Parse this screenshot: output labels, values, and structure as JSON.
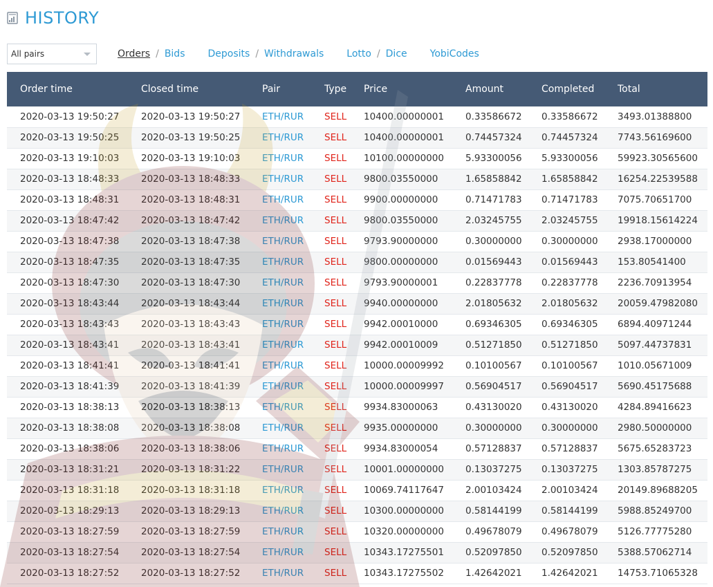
{
  "header": {
    "title": "HISTORY",
    "icon": "history-book-icon"
  },
  "filter": {
    "selected": "All pairs"
  },
  "nav": {
    "groups": [
      [
        {
          "label": "Orders",
          "active": true
        },
        {
          "label": "Bids",
          "active": false
        }
      ],
      [
        {
          "label": "Deposits",
          "active": false
        },
        {
          "label": "Withdrawals",
          "active": false
        }
      ],
      [
        {
          "label": "Lotto",
          "active": false
        },
        {
          "label": "Dice",
          "active": false
        }
      ],
      [
        {
          "label": "YobiCodes",
          "active": false
        }
      ]
    ],
    "separator": "/"
  },
  "table": {
    "columns": [
      "Order time",
      "Closed time",
      "Pair",
      "Type",
      "Price",
      "Amount",
      "Completed",
      "Total"
    ],
    "rows": [
      [
        "2020-03-13 19:50:27",
        "2020-03-13 19:50:27",
        "ETH/RUR",
        "SELL",
        "10400.00000001",
        "0.33586672",
        "0.33586672",
        "3493.01388800"
      ],
      [
        "2020-03-13 19:50:25",
        "2020-03-13 19:50:25",
        "ETH/RUR",
        "SELL",
        "10400.00000001",
        "0.74457324",
        "0.74457324",
        "7743.56169600"
      ],
      [
        "2020-03-13 19:10:03",
        "2020-03-13 19:10:03",
        "ETH/RUR",
        "SELL",
        "10100.00000000",
        "5.93300056",
        "5.93300056",
        "59923.30565600"
      ],
      [
        "2020-03-13 18:48:33",
        "2020-03-13 18:48:33",
        "ETH/RUR",
        "SELL",
        "9800.03550000",
        "1.65858842",
        "1.65858842",
        "16254.22539588"
      ],
      [
        "2020-03-13 18:48:31",
        "2020-03-13 18:48:31",
        "ETH/RUR",
        "SELL",
        "9900.00000000",
        "0.71471783",
        "0.71471783",
        "7075.70651700"
      ],
      [
        "2020-03-13 18:47:42",
        "2020-03-13 18:47:42",
        "ETH/RUR",
        "SELL",
        "9800.03550000",
        "2.03245755",
        "2.03245755",
        "19918.15614224"
      ],
      [
        "2020-03-13 18:47:38",
        "2020-03-13 18:47:38",
        "ETH/RUR",
        "SELL",
        "9793.90000000",
        "0.30000000",
        "0.30000000",
        "2938.17000000"
      ],
      [
        "2020-03-13 18:47:35",
        "2020-03-13 18:47:35",
        "ETH/RUR",
        "SELL",
        "9800.00000000",
        "0.01569443",
        "0.01569443",
        "153.80541400"
      ],
      [
        "2020-03-13 18:47:30",
        "2020-03-13 18:47:30",
        "ETH/RUR",
        "SELL",
        "9793.90000001",
        "0.22837778",
        "0.22837778",
        "2236.70913954"
      ],
      [
        "2020-03-13 18:43:44",
        "2020-03-13 18:43:44",
        "ETH/RUR",
        "SELL",
        "9940.00000000",
        "2.01805632",
        "2.01805632",
        "20059.47982080"
      ],
      [
        "2020-03-13 18:43:43",
        "2020-03-13 18:43:43",
        "ETH/RUR",
        "SELL",
        "9942.00010000",
        "0.69346305",
        "0.69346305",
        "6894.40971244"
      ],
      [
        "2020-03-13 18:43:41",
        "2020-03-13 18:43:41",
        "ETH/RUR",
        "SELL",
        "9942.00010009",
        "0.51271850",
        "0.51271850",
        "5097.44737831"
      ],
      [
        "2020-03-13 18:41:41",
        "2020-03-13 18:41:41",
        "ETH/RUR",
        "SELL",
        "10000.00009992",
        "0.10100567",
        "0.10100567",
        "1010.05671009"
      ],
      [
        "2020-03-13 18:41:39",
        "2020-03-13 18:41:39",
        "ETH/RUR",
        "SELL",
        "10000.00009997",
        "0.56904517",
        "0.56904517",
        "5690.45175688"
      ],
      [
        "2020-03-13 18:38:13",
        "2020-03-13 18:38:13",
        "ETH/RUR",
        "SELL",
        "9934.83000063",
        "0.43130020",
        "0.43130020",
        "4284.89416623"
      ],
      [
        "2020-03-13 18:38:08",
        "2020-03-13 18:38:08",
        "ETH/RUR",
        "SELL",
        "9935.00000000",
        "0.30000000",
        "0.30000000",
        "2980.50000000"
      ],
      [
        "2020-03-13 18:38:06",
        "2020-03-13 18:38:06",
        "ETH/RUR",
        "SELL",
        "9934.83000054",
        "0.57128837",
        "0.57128837",
        "5675.65283723"
      ],
      [
        "2020-03-13 18:31:21",
        "2020-03-13 18:31:22",
        "ETH/RUR",
        "SELL",
        "10001.00000000",
        "0.13037275",
        "0.13037275",
        "1303.85787275"
      ],
      [
        "2020-03-13 18:31:18",
        "2020-03-13 18:31:18",
        "ETH/RUR",
        "SELL",
        "10069.74117647",
        "2.00103424",
        "2.00103424",
        "20149.89688205"
      ],
      [
        "2020-03-13 18:29:13",
        "2020-03-13 18:29:13",
        "ETH/RUR",
        "SELL",
        "10300.00000000",
        "0.58144199",
        "0.58144199",
        "5988.85249700"
      ],
      [
        "2020-03-13 18:27:59",
        "2020-03-13 18:27:59",
        "ETH/RUR",
        "SELL",
        "10320.00000000",
        "0.49678079",
        "0.49678079",
        "5126.77775280"
      ],
      [
        "2020-03-13 18:27:54",
        "2020-03-13 18:27:54",
        "ETH/RUR",
        "SELL",
        "10343.17275501",
        "0.52097850",
        "0.52097850",
        "5388.57062714"
      ],
      [
        "2020-03-13 18:27:52",
        "2020-03-13 18:27:52",
        "ETH/RUR",
        "SELL",
        "10343.17275502",
        "1.42642021",
        "1.42642021",
        "14753.71065328"
      ]
    ]
  },
  "colors": {
    "accent": "#2e9ad4",
    "header_bg": "#455a75",
    "sell": "#e0231a"
  }
}
